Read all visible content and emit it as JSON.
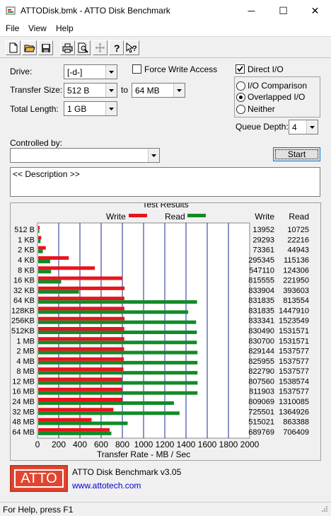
{
  "window": {
    "title": "ATTODisk.bmk - ATTO Disk Benchmark",
    "minimize": "─",
    "maximize": "☐",
    "close": "✕"
  },
  "menu": {
    "file": "File",
    "view": "View",
    "help": "Help"
  },
  "toolbar": {
    "icons": [
      "new-file-icon",
      "open-folder-icon",
      "save-icon",
      "print-icon",
      "print-preview-icon",
      "move-icon",
      "about-icon",
      "context-help-icon"
    ]
  },
  "form": {
    "drive_label": "Drive:",
    "drive_value": "[-d-]",
    "transfer_size_label": "Transfer Size:",
    "transfer_from": "512 B",
    "to_label": "to",
    "transfer_to": "64 MB",
    "total_length_label": "Total Length:",
    "total_length_value": "1 GB",
    "force_write_label": "Force Write Access",
    "force_write_checked": false,
    "direct_io_label": "Direct I/O",
    "direct_io_checked": true,
    "io_options": [
      "I/O Comparison",
      "Overlapped I/O",
      "Neither"
    ],
    "io_selected": "Overlapped I/O",
    "queue_depth_label": "Queue Depth:",
    "queue_depth_value": "4",
    "controlled_by_label": "Controlled by:",
    "controlled_by_value": "",
    "start_label": "Start",
    "description": "<< Description >>"
  },
  "results": {
    "group_title": "Test Results",
    "write_col_header": "Write",
    "read_col_header": "Read"
  },
  "chart_data": {
    "type": "bar",
    "orientation": "horizontal",
    "legend": [
      "Write",
      "Read"
    ],
    "legend_position": "top",
    "xlabel": "Transfer Rate - MB / Sec",
    "xlim": [
      0,
      2000
    ],
    "xticks": [
      "0",
      "200",
      "400",
      "600",
      "800",
      "1000",
      "1200",
      "1400",
      "1600",
      "1800",
      "2000"
    ],
    "grid": true,
    "categories": [
      "512 B",
      "1 KB",
      "2 KB",
      "4 KB",
      "8 KB",
      "16 KB",
      "32 KB",
      "64 KB",
      "128KB",
      "256KB",
      "512KB",
      "1 MB",
      "2 MB",
      "4 MB",
      "8 MB",
      "12 MB",
      "16 MB",
      "24 MB",
      "32 MB",
      "48 MB",
      "64 MB"
    ],
    "series": [
      {
        "name": "Write",
        "color": "#e8141c",
        "values": [
          13.6,
          28.6,
          71.6,
          288.4,
          534.3,
          796.4,
          814.4,
          812.3,
          812.3,
          813.8,
          811.0,
          811.2,
          809.7,
          806.6,
          803.5,
          788.6,
          792.9,
          790.1,
          708.5,
          503.0,
          673.6
        ]
      },
      {
        "name": "Read",
        "color": "#138a29",
        "values": [
          10.5,
          21.7,
          43.9,
          112.4,
          121.2,
          216.6,
          384.4,
          1497.6,
          1413.8,
          1488.8,
          1495.7,
          1495.7,
          1501.5,
          1501.5,
          1501.5,
          1502.5,
          1501.5,
          1279.4,
          1332.4,
          843.1,
          689.9
        ]
      }
    ],
    "write_table": [
      "13952",
      "29293",
      "73361",
      "295345",
      "547110",
      "815555",
      "833904",
      "831835",
      "831835",
      "833341",
      "830490",
      "830700",
      "829144",
      "825955",
      "822790",
      "807560",
      "811903",
      "809069",
      "725501",
      "515021",
      "689769"
    ],
    "read_table": [
      "10725",
      "22216",
      "44943",
      "115136",
      "124306",
      "221950",
      "393603",
      "813554",
      "1447910",
      "1523549",
      "1531571",
      "1531571",
      "1537577",
      "1537577",
      "1537577",
      "1538574",
      "1537577",
      "1310085",
      "1364926",
      "863388",
      "706409"
    ]
  },
  "footer": {
    "logo_text": "ATTO",
    "product": "ATTO Disk Benchmark v3.05",
    "link": "www.attotech.com",
    "status": "For Help, press F1"
  },
  "colors": {
    "write": "#e8141c",
    "read": "#138a29",
    "logo_bg": "#e2452f",
    "link": "#0000cc"
  }
}
